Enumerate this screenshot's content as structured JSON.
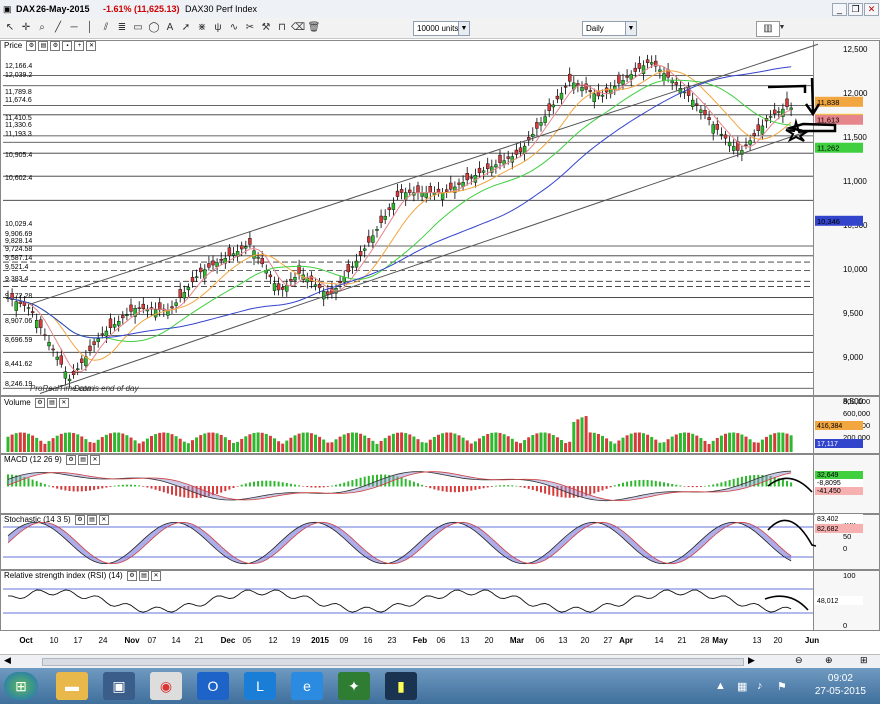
{
  "title_bar": {
    "symbol": "DAX",
    "date": "26-May-2015",
    "change": "-1.61% (11,625.13)",
    "instrument": "DAX30 Perf Index"
  },
  "toolbar": {
    "units_value": "10000 units",
    "period_value": "Daily"
  },
  "panels": {
    "price": {
      "label": "Price",
      "watermark": "Data is end of day",
      "right_axis": [
        "12,500",
        "12,000",
        "11,500",
        "11,000",
        "10,500",
        "10,000",
        "9,500",
        "9,000",
        "8,500"
      ],
      "left_levels": [
        "12,166.4",
        "12,039.2",
        "11,789.8",
        "11,674.6",
        "11,410.5",
        "11,330.6",
        "11,193.3",
        "10,905.4",
        "10,602.4",
        "10,029.4",
        "9,906.69",
        "9,828.14",
        "9,724.58",
        "9,587.14",
        "9,521.4",
        "9,383.4",
        "9,172.28",
        "8,907.06",
        "8,696.59",
        "8,441.62",
        "8,246.19"
      ],
      "tags": {
        "last": "11,625.13",
        "t1": "11,838",
        "t2": "11,613",
        "t3": "11,262",
        "t4": "10,346"
      }
    },
    "volume": {
      "label": "Volume",
      "right_axis": [
        "800,000",
        "600,000",
        "400,000",
        "200,000"
      ],
      "tags": {
        "v1": "416,384",
        "v2": "17,117"
      }
    },
    "macd": {
      "label": "MACD (12 26 9)",
      "tags": {
        "m1": "32,649",
        "m2": "-8,8095",
        "m3": "-41,450"
      }
    },
    "stochastic": {
      "label": "Stochastic (14 3 5)",
      "right_axis": [
        "100",
        "50",
        "0"
      ],
      "tags": {
        "s1": "83,402",
        "s2": "82,682"
      }
    },
    "rsi": {
      "label": "Relative strength index (RSI) (14)",
      "right_axis": [
        "100",
        "50",
        "0"
      ],
      "tags": {
        "r1": "48,012"
      }
    }
  },
  "x_axis": [
    "Oct",
    "10",
    "17",
    "24",
    "Nov",
    "07",
    "14",
    "21",
    "Dec",
    "05",
    "12",
    "19",
    "2015",
    "09",
    "16",
    "23",
    "Feb",
    "06",
    "13",
    "20",
    "Mar",
    "06",
    "13",
    "20",
    "27",
    "Apr",
    "14",
    "21",
    "28",
    "May",
    "13",
    "20",
    "Jun"
  ],
  "watermark_brand": "ProRealTime.com",
  "taskbar": {
    "time": "09:02",
    "date": "27-05-2015"
  },
  "colors": {
    "up": "#2eb82e",
    "down": "#d63b3b",
    "ma20": "#e6868c",
    "ma50": "#f2a640",
    "ma100": "#3fcf3f",
    "ma200": "#3344cc",
    "channel": "#555555"
  },
  "chart_data": [
    {
      "type": "line",
      "title": "DAX",
      "ylabel": "",
      "ylim": [
        8250,
        12600
      ],
      "x": [
        "Oct",
        "Nov",
        "Dec",
        "2015",
        "Feb",
        "Mar",
        "Apr",
        "May"
      ],
      "series": [
        {
          "values": [
            9200,
            9400,
            9900,
            9800,
            10900,
            11800,
            12300,
            11625
          ]
        }
      ]
    }
  ]
}
